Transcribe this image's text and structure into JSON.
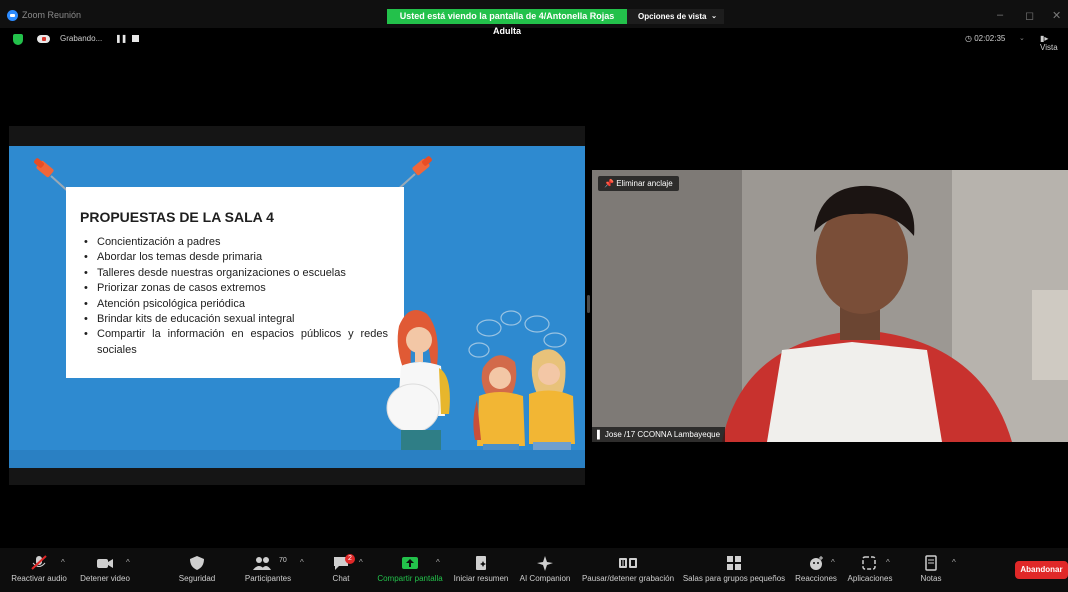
{
  "window": {
    "title": "Zoom Reunión",
    "share_banner": "Usted está viendo la pantalla de 4/Antonella Rojas Adulta",
    "view_options": "Opciones de vista"
  },
  "status": {
    "recording": "Grabando...",
    "timer": "02:02:35",
    "view": "Vista"
  },
  "slide": {
    "title": "PROPUESTAS DE LA SALA 4",
    "bullets": [
      "Concientización a padres",
      "Abordar los temas desde primaria",
      "Talleres desde nuestras organizaciones o escuelas",
      "Priorizar zonas de casos extremos",
      "Atención psicológica periódica",
      "Brindar kits de educación sexual integral",
      "Compartir la información en espacios públicos y redes sociales"
    ]
  },
  "video": {
    "unpin": "Eliminar anclaje",
    "participant_name": "Jose /17 CCONNA Lambayeque"
  },
  "toolbar": {
    "unmute": "Reactivar audio",
    "stop_video": "Detener video",
    "security": "Seguridad",
    "participants": "Participantes",
    "participants_count": "70",
    "chat": "Chat",
    "chat_badge": "2",
    "share": "Compartir pantalla",
    "summary": "Iniciar resumen",
    "ai": "AI Companion",
    "record": "Pausar/detener grabación",
    "breakout": "Salas para grupos pequeños",
    "reactions": "Reacciones",
    "apps": "Aplicaciones",
    "notes": "Notas",
    "leave": "Abandonar"
  },
  "colors": {
    "share_green": "#23c14b",
    "slide_blue": "#2e8ad0",
    "leave_red": "#e02828",
    "toolbar_bg": "#0d0d0d"
  }
}
